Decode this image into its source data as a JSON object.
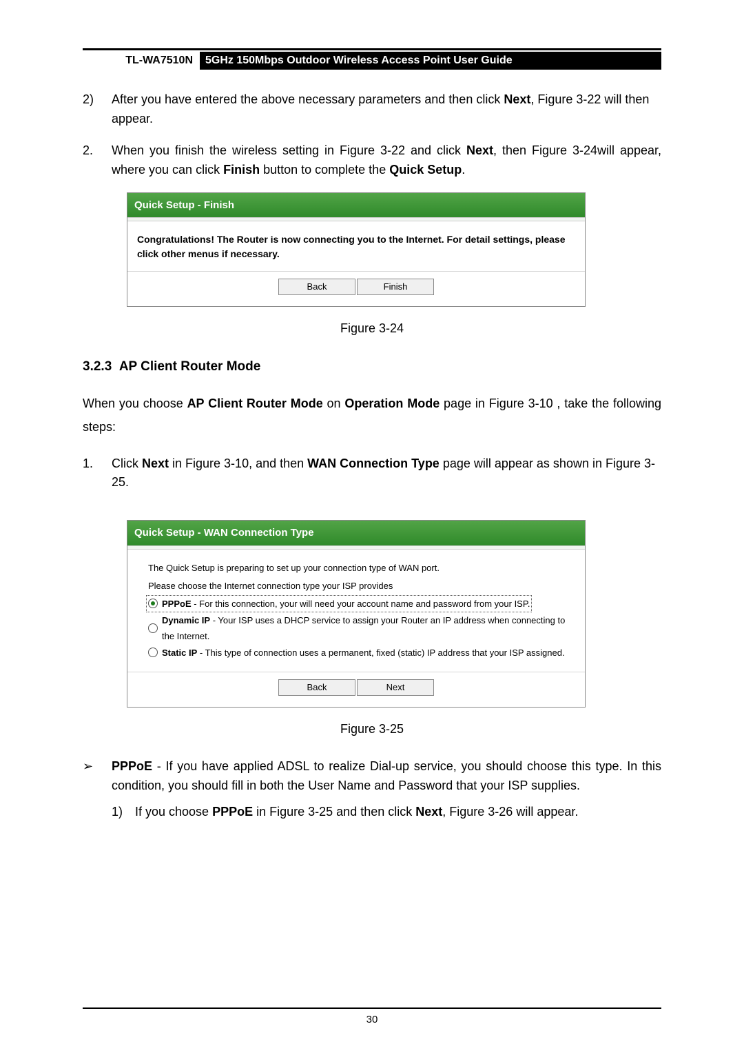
{
  "header": {
    "model": "TL-WA7510N",
    "title": "5GHz 150Mbps Outdoor Wireless Access Point User Guide"
  },
  "para_2sub": {
    "marker": "2)",
    "text_a": "After you have entered the above necessary parameters and then click ",
    "bold_next": "Next",
    "text_b": ", Figure 3-22 will then appear."
  },
  "para_2": {
    "marker": "2.",
    "text_a": "When you finish the wireless setting in Figure 3-22 and click ",
    "bold_next": "Next",
    "text_b": ", then Figure 3-24will appear, where you can click ",
    "bold_finish": "Finish",
    "text_c": " button to complete the ",
    "bold_qs": "Quick Setup",
    "text_d": "."
  },
  "fig24": {
    "header": "Quick Setup - Finish",
    "body": "Congratulations! The Router is now connecting you to the Internet. For detail settings, please click other menus if necessary.",
    "back": "Back",
    "finish": "Finish",
    "caption": "Figure 3-24"
  },
  "section": {
    "number": "3.2.3",
    "title": "AP Client Router Mode"
  },
  "section_intro": {
    "a": "When you choose ",
    "b": "AP Client Router Mode",
    "c": " on ",
    "d": "Operation Mode",
    "e": " page in Figure 3-10 , take the following steps:"
  },
  "step1": {
    "marker": "1.",
    "a": "Click ",
    "b": "Next",
    "c": " in Figure 3-10, and then ",
    "d": "WAN Connection Type",
    "e": " page will appear as shown in Figure 3-25."
  },
  "fig25": {
    "header": "Quick Setup - WAN Connection Type",
    "line1": "The Quick Setup is preparing to set up your connection type of WAN port.",
    "line2": "Please choose the Internet connection type your ISP provides",
    "opt1_b": "PPPoE",
    "opt1_t": " - For this connection, your will need your account name and password from your ISP.",
    "opt2_b": "Dynamic IP",
    "opt2_t": " - Your ISP uses a DHCP service to assign your Router an IP address when connecting to the Internet.",
    "opt3_b": "Static IP",
    "opt3_t": " - This type of connection uses a permanent, fixed (static) IP address that your ISP assigned.",
    "back": "Back",
    "next": "Next",
    "caption": "Figure 3-25"
  },
  "pppoe": {
    "arrow": "➢",
    "b": "PPPoE",
    "t": " - If you have applied ADSL to realize Dial-up service, you should choose this type. In this condition, you should fill in both the User Name and Password that your ISP supplies."
  },
  "pppoe_sub": {
    "marker": "1)",
    "a": "If you choose ",
    "b": "PPPoE",
    "c": " in Figure 3-25 and then click ",
    "d": "Next",
    "e": ", Figure 3-26 will appear."
  },
  "footer": {
    "page": "30"
  }
}
